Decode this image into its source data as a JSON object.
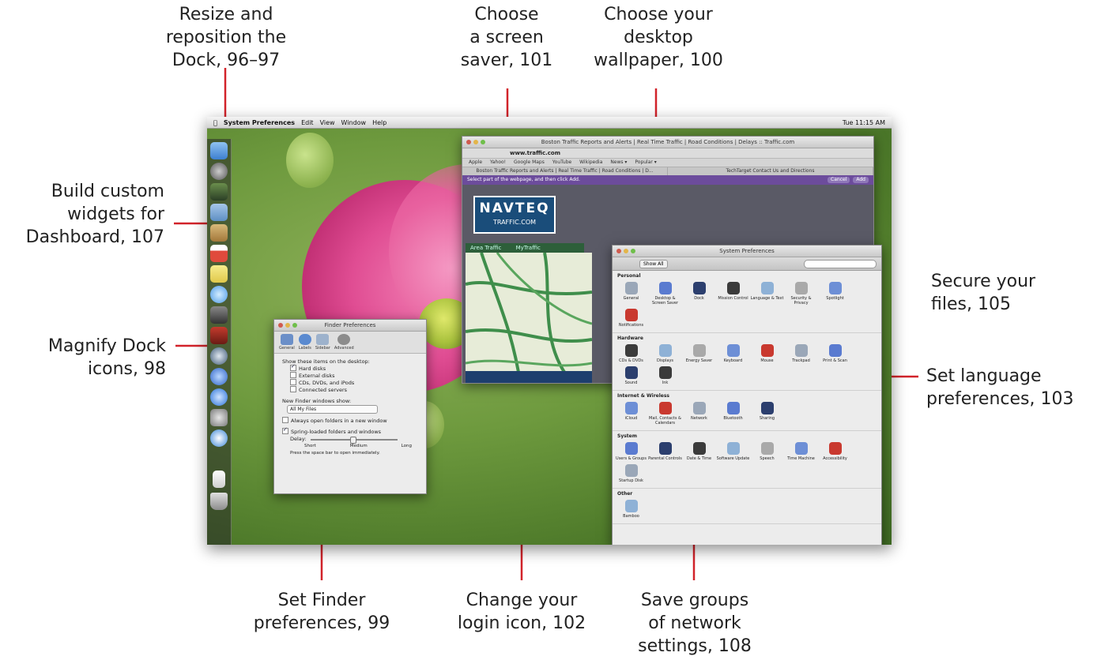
{
  "callouts": {
    "dock_resize": [
      "Resize and",
      "reposition the",
      "Dock, 96–97"
    ],
    "screen_saver": [
      "Choose",
      "a screen",
      "saver, 101"
    ],
    "wallpaper": [
      "Choose your",
      "desktop",
      "wallpaper, 100"
    ],
    "widgets": [
      "Build custom",
      "widgets for",
      "Dashboard, 107"
    ],
    "secure": [
      "Secure your",
      "files, 105"
    ],
    "magnify": [
      "Magnify Dock",
      "icons, 98"
    ],
    "language": [
      "Set language",
      "preferences, 103"
    ],
    "finder": [
      "Set Finder",
      "preferences, 99"
    ],
    "login": [
      "Change your",
      "login icon, 102"
    ],
    "network": [
      "Save groups",
      "of network",
      "settings, 108"
    ]
  },
  "menubar": {
    "app": "System Preferences",
    "items": [
      "Edit",
      "View",
      "Window",
      "Help"
    ],
    "clock": "Tue 11:15 AM"
  },
  "browser": {
    "title": "Boston Traffic Reports and Alerts | Real Time Traffic | Road Conditions | Delays :: Traffic.com",
    "url": "www.traffic.com",
    "bookmarks": [
      "Apple",
      "Yahoo!",
      "Google Maps",
      "YouTube",
      "Wikipedia",
      "News ▾",
      "Popular ▾"
    ],
    "tabs": [
      "Boston Traffic Reports and Alerts | Real Time Traffic | Road Conditions | D...",
      "TechTarget Contact Us and Directions"
    ],
    "clip_prompt": "Select part of the webpage, and then click Add.",
    "cancel": "Cancel",
    "add": "Add",
    "logo": "NAVTEQ",
    "logo_sub": "TRAFFIC.COM",
    "tab_area": "Area Traffic",
    "tab_my": "MyTraffic"
  },
  "syspref": {
    "title": "System Preferences",
    "show_all": "Show All",
    "sections": [
      {
        "name": "Personal",
        "items": [
          "General",
          "Desktop & Screen Saver",
          "Dock",
          "Mission Control",
          "Language & Text",
          "Security & Privacy",
          "Spotlight",
          "Notifications"
        ]
      },
      {
        "name": "Hardware",
        "items": [
          "CDs & DVDs",
          "Displays",
          "Energy Saver",
          "Keyboard",
          "Mouse",
          "Trackpad",
          "Print & Scan",
          "Sound",
          "Ink"
        ]
      },
      {
        "name": "Internet & Wireless",
        "items": [
          "iCloud",
          "Mail, Contacts & Calendars",
          "Network",
          "Bluetooth",
          "Sharing"
        ]
      },
      {
        "name": "System",
        "items": [
          "Users & Groups",
          "Parental Controls",
          "Date & Time",
          "Software Update",
          "Speech",
          "Time Machine",
          "Accessibility",
          "Startup Disk"
        ]
      },
      {
        "name": "Other",
        "items": [
          "Bamboo"
        ]
      }
    ],
    "colors": [
      "#9aa7b8",
      "#5a7bd0",
      "#2c3f6e",
      "#3b3b3b",
      "#8eb1d6",
      "#a9a9a9",
      "#6d8fd6",
      "#c9392f"
    ]
  },
  "finder": {
    "title": "Finder Preferences",
    "toolbar": [
      "General",
      "Labels",
      "Sidebar",
      "Advanced"
    ],
    "show_heading": "Show these items on the desktop:",
    "checks": [
      {
        "label": "Hard disks",
        "on": true
      },
      {
        "label": "External disks",
        "on": false
      },
      {
        "label": "CDs, DVDs, and iPods",
        "on": false
      },
      {
        "label": "Connected servers",
        "on": false
      }
    ],
    "new_windows": "New Finder windows show:",
    "new_windows_value": "All My Files",
    "open_folders": "Always open folders in a new window",
    "spring": "Spring-loaded folders and windows",
    "delay": "Delay:",
    "delay_labels": [
      "Short",
      "Medium",
      "Long"
    ],
    "hint": "Press the space bar to open immediately."
  }
}
